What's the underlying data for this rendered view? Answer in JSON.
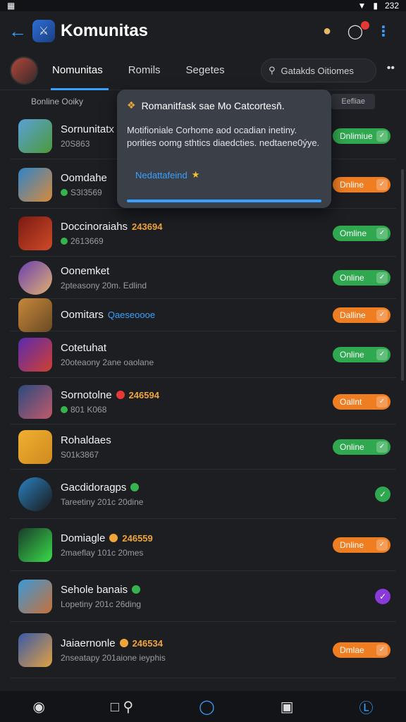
{
  "status_bar": {
    "left_icon": "notification-icon",
    "time": "232"
  },
  "header": {
    "title": "Komunitas"
  },
  "tabs": [
    {
      "label": "Nomunitas"
    },
    {
      "label": "Romils"
    },
    {
      "label": "Segetes"
    }
  ],
  "search": {
    "text": "Gatakds  Oitiomes"
  },
  "tab_more": "••",
  "list_header": {
    "left": "Bonline  Ooiky",
    "right": "Eefliae"
  },
  "tooltip": {
    "title": "Romanitfask sae Mo Catcortesň.",
    "body": "Motifioniale Corhome aod ocadian inetiny. porities oomg sthtics diaedcties. nedtaene0ýye.",
    "link": "Nedattafeind",
    "star": "★"
  },
  "rows": [
    {
      "name": "Sornunitatx",
      "score": "",
      "sub": "20S863",
      "status": "Dnlimiue",
      "status_color": "green",
      "icon_colors": [
        "#5aa0d8",
        "#4c9a3a"
      ]
    },
    {
      "name": "Oomdahe",
      "score": "",
      "sub": "S3I3569",
      "status": "Dnline",
      "status_color": "orange",
      "icon_colors": [
        "#2f84c9",
        "#d88a3a"
      ],
      "sub_dot": "#37b24d"
    },
    {
      "name": "Doccinoraiahs",
      "score": "243694",
      "sub": "2613669",
      "status": "Omline",
      "status_color": "green",
      "icon_colors": [
        "#7a1a12",
        "#d04a28"
      ],
      "sub_dot": "#37b24d"
    },
    {
      "name": "Oonemket",
      "score": "",
      "sub": "2pteasony 20m. Edlind",
      "status": "Online",
      "status_color": "green",
      "icon_colors": [
        "#6a3fb0",
        "#e0b070"
      ],
      "round": true
    },
    {
      "name": "Oomitars",
      "tag": "Qaeseoooe",
      "sub": "",
      "status": "Dalline",
      "status_color": "orange",
      "icon_colors": [
        "#c7883a",
        "#6a4a24"
      ]
    },
    {
      "name": "Cotetuhat",
      "score": "",
      "sub": "20oteaony 2ane oaolane",
      "status": "Online",
      "status_color": "green",
      "icon_colors": [
        "#5a2ab0",
        "#d04030"
      ]
    },
    {
      "name": "Sornotolne",
      "score": "246594",
      "sub": "801 K068",
      "status": "Oallnt",
      "status_color": "orange",
      "icon_colors": [
        "#2a4a80",
        "#c05a6a"
      ],
      "name_dot": "#e53935",
      "sub_dot": "#37b24d"
    },
    {
      "name": "Rohaldaes",
      "score": "",
      "sub": "S01k3867",
      "status": "Online",
      "status_color": "green",
      "icon_colors": [
        "#f0b030",
        "#d08a20"
      ]
    },
    {
      "name": "Gacdidoragps",
      "score": "",
      "sub": "Tareetiny 201c 20dine",
      "status": "",
      "status_color": "green-circle",
      "icon_colors": [
        "#2a80c0",
        "#1a1a1a"
      ],
      "round": true,
      "name_dot": "#37b24d"
    },
    {
      "name": "Domiagle",
      "score": "246559",
      "sub": "2maeflay 101c 20mes",
      "status": "Dnline",
      "status_color": "orange",
      "icon_colors": [
        "#1a3a2a",
        "#3adc4a"
      ],
      "name_dot": "#f0a53a"
    },
    {
      "name": "Sehole banais",
      "score": "",
      "sub": "Lopetiny 201c 26ding",
      "status": "",
      "status_color": "purple-circle",
      "icon_colors": [
        "#3a9ad8",
        "#c8703a"
      ],
      "name_dot": "#37b24d"
    },
    {
      "name": "Jaiaernonle",
      "score": "246534",
      "sub": "2nseatapy 201aione ieyphis",
      "status": "Dmlae",
      "status_color": "orange",
      "icon_colors": [
        "#3a5aa8",
        "#e0a040"
      ],
      "name_dot": "#f0a53a"
    }
  ],
  "colors": {
    "accent": "#3aa0ff",
    "online": "#2fa84f",
    "offline": "#ef7d22",
    "purple": "#8a3ad8"
  },
  "bottom_nav": [
    "home-icon",
    "gallery-icon",
    "search-icon",
    "explore-icon",
    "edit-icon",
    "profile-icon"
  ]
}
